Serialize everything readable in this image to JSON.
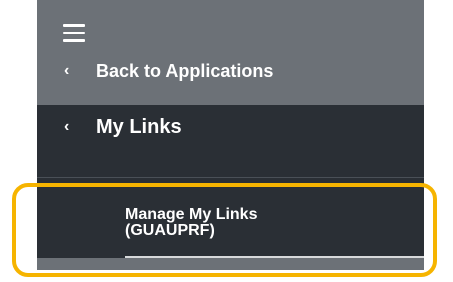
{
  "menu": {
    "icon": "hamburger-menu-icon",
    "back_label": "Back to Applications",
    "section_label": "My Links",
    "chevron_icon": "chevron-left-icon",
    "items": [
      {
        "label_line1": "Manage My Links",
        "label_line2": "(GUAUPRF)"
      }
    ]
  },
  "colors": {
    "top_bar": "#6c7177",
    "panel": "#2a2f35",
    "highlight": "#f6b400"
  }
}
